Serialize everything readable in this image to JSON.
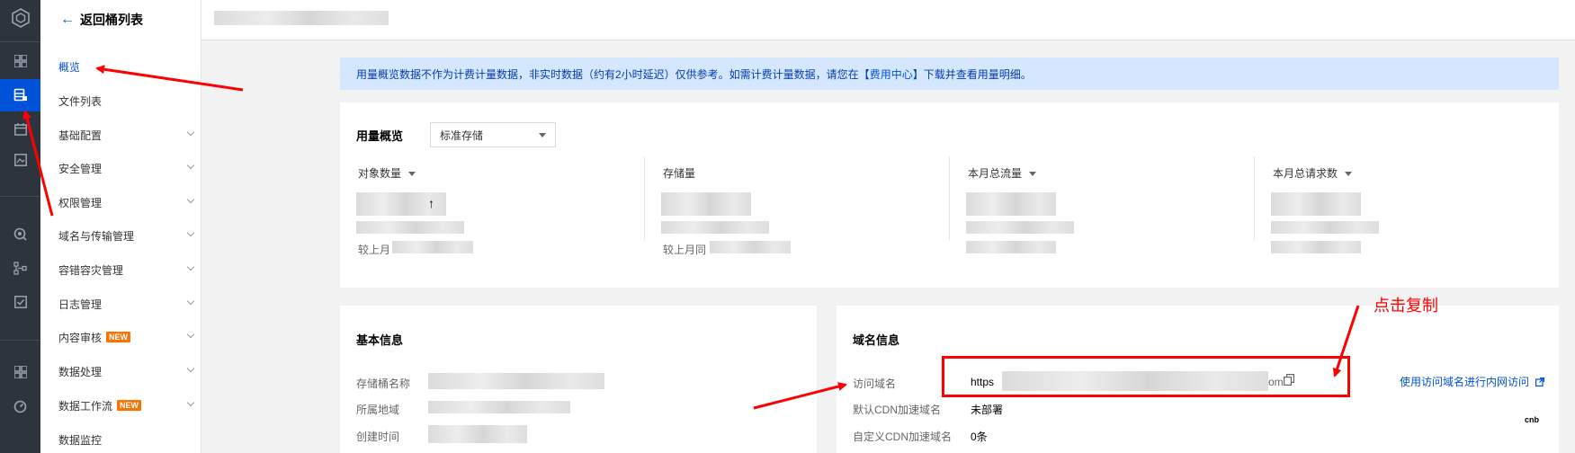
{
  "rail": {
    "icons": [
      "logo-icon",
      "dashboard-icon",
      "bucket-icon",
      "calendar-icon",
      "image-icon",
      "search-icon",
      "network-icon",
      "check-icon",
      "grid-icon",
      "speed-icon"
    ]
  },
  "menu": {
    "back_label": "返回桶列表",
    "items": [
      {
        "label": "概览",
        "active": true,
        "expandable": false
      },
      {
        "label": "文件列表",
        "active": false,
        "expandable": false
      },
      {
        "label": "基础配置",
        "active": false,
        "expandable": true
      },
      {
        "label": "安全管理",
        "active": false,
        "expandable": true
      },
      {
        "label": "权限管理",
        "active": false,
        "expandable": true
      },
      {
        "label": "域名与传输管理",
        "active": false,
        "expandable": true
      },
      {
        "label": "容错容灾管理",
        "active": false,
        "expandable": true
      },
      {
        "label": "日志管理",
        "active": false,
        "expandable": true
      },
      {
        "label": "内容审核",
        "active": false,
        "expandable": true,
        "badge": "NEW"
      },
      {
        "label": "数据处理",
        "active": false,
        "expandable": true
      },
      {
        "label": "数据工作流",
        "active": false,
        "expandable": true,
        "badge": "NEW"
      },
      {
        "label": "数据监控",
        "active": false,
        "expandable": false
      }
    ]
  },
  "notice": {
    "text_before": "用量概览数据不作为计费计量数据，非实时数据（约有2小时延迟）仅供参考。如需计费计量数据，请您在【",
    "link": "费用中心",
    "text_after": "】下载并查看用量明细。"
  },
  "usage": {
    "title": "用量概览",
    "select_value": "标准存储",
    "stats": [
      {
        "label": "对象数量",
        "dropdown": true,
        "compare": "较上月"
      },
      {
        "label": "存储量",
        "dropdown": false,
        "compare": "较上月同"
      },
      {
        "label": "本月总流量",
        "dropdown": true,
        "compare": ""
      },
      {
        "label": "本月总请求数",
        "dropdown": true,
        "compare": ""
      }
    ],
    "up_arrow": "↑"
  },
  "basic": {
    "title": "基本信息",
    "rows": [
      {
        "label": "存储桶名称"
      },
      {
        "label": "所属地域"
      },
      {
        "label": "创建时间"
      }
    ]
  },
  "domain": {
    "title": "域名信息",
    "rows": [
      {
        "label": "访问域名",
        "value": "https",
        "suffix": "om"
      },
      {
        "label": "默认CDN加速域名",
        "value": "未部署"
      },
      {
        "label": "自定义CDN加速域名",
        "value": "0条"
      }
    ],
    "internal_link": "使用访问域名进行内网访问"
  },
  "annotation": {
    "copy_hint": "点击复制"
  },
  "colors": {
    "accent": "#0052d9",
    "rail": "#2e343e",
    "notice_bg": "#d5e7ff",
    "annotation": "#ff0000",
    "badge": "#ff7200"
  }
}
